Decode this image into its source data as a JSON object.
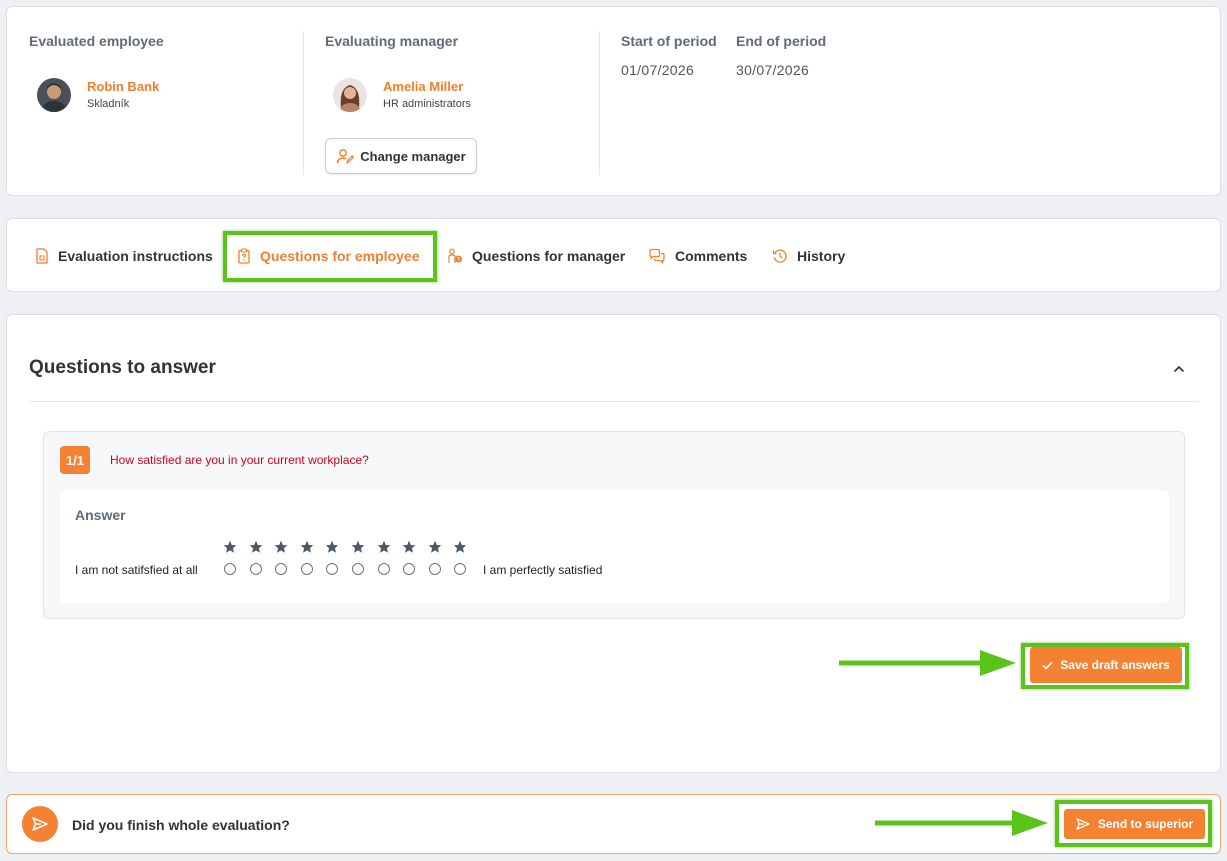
{
  "employee": {
    "title": "Evaluated employee",
    "name": "Robin Bank",
    "role": "Skladník"
  },
  "manager": {
    "title": "Evaluating manager",
    "name": "Amelia Miller",
    "role": "HR administrators",
    "change_label": "Change manager"
  },
  "period": {
    "start_title": "Start of period",
    "start_date": "01/07/2026",
    "end_title": "End of period",
    "end_date": "30/07/2026"
  },
  "tabs": [
    {
      "label": "Evaluation instructions",
      "icon": "document-icon"
    },
    {
      "label": "Questions for employee",
      "icon": "clipboard-question-icon",
      "active": true
    },
    {
      "label": "Questions for manager",
      "icon": "person-question-icon"
    },
    {
      "label": "Comments",
      "icon": "chat-bubbles-icon"
    },
    {
      "label": "History",
      "icon": "history-icon"
    }
  ],
  "main": {
    "title": "Questions to answer",
    "question": {
      "number": "1/1",
      "text": "How satisfied are you in your current workplace?",
      "answer_label": "Answer",
      "scale_low": "I am not satifsfied at all",
      "scale_high": "I am perfectly satisfied",
      "scale_points": 10,
      "selected": null
    },
    "save_label": "Save draft answers"
  },
  "finish": {
    "text": "Did you finish whole evaluation?",
    "send_label": "Send to superior"
  },
  "colors": {
    "accent": "#f58233",
    "highlight": "#5ac41a",
    "question_text": "#d0021b"
  }
}
